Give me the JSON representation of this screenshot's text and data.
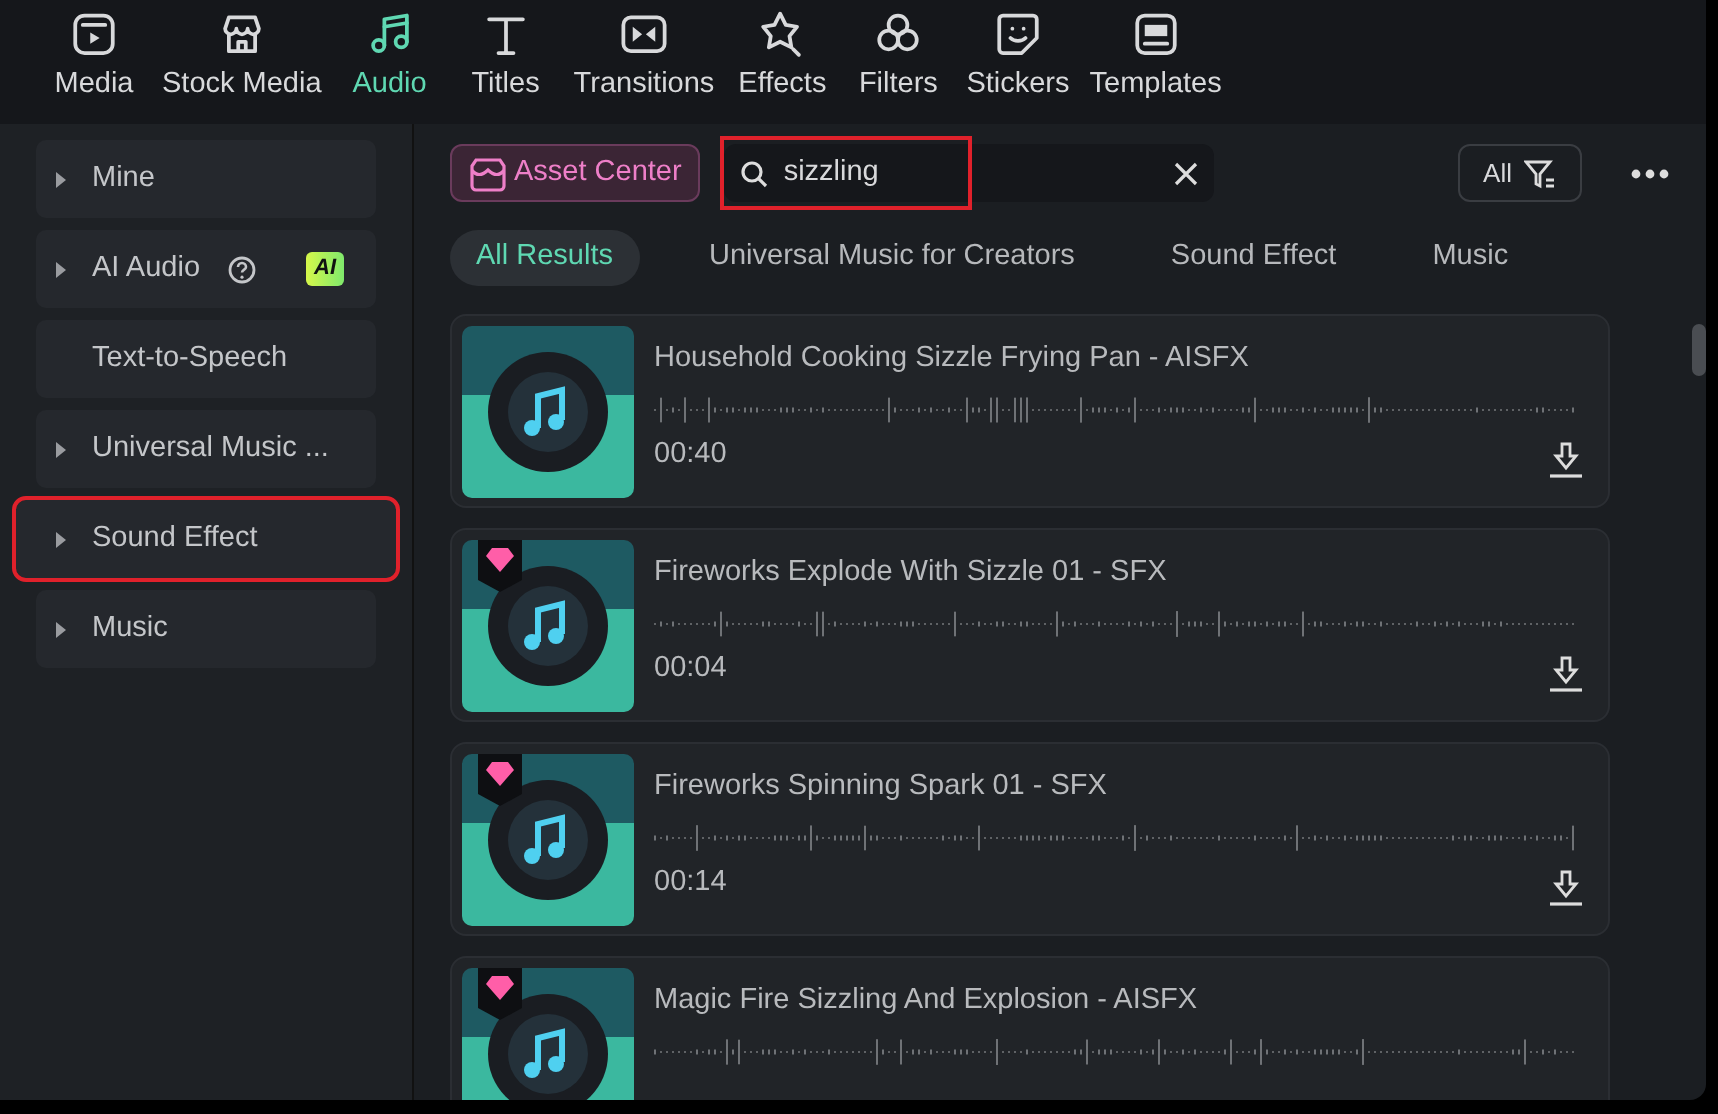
{
  "toolbar": [
    {
      "label": "Media",
      "selected": false,
      "kind": "media"
    },
    {
      "label": "Stock Media",
      "selected": false,
      "kind": "store"
    },
    {
      "label": "Audio",
      "selected": true,
      "kind": "music"
    },
    {
      "label": "Titles",
      "selected": false,
      "kind": "title"
    },
    {
      "label": "Transitions",
      "selected": false,
      "kind": "transition"
    },
    {
      "label": "Effects",
      "selected": false,
      "kind": "star"
    },
    {
      "label": "Filters",
      "selected": false,
      "kind": "filter"
    },
    {
      "label": "Stickers",
      "selected": false,
      "kind": "sticker"
    },
    {
      "label": "Templates",
      "selected": false,
      "kind": "template"
    }
  ],
  "sidebar": {
    "items": [
      {
        "label": "Mine",
        "expandable": true,
        "highlighted": false
      },
      {
        "label": "AI Audio",
        "expandable": true,
        "highlighted": false,
        "help": true,
        "badge": "AI"
      },
      {
        "label": "Text-to-Speech",
        "expandable": false,
        "highlighted": false
      },
      {
        "label": "Universal Music ...",
        "expandable": true,
        "highlighted": false
      },
      {
        "label": "Sound Effect",
        "expandable": true,
        "highlighted": true
      },
      {
        "label": "Music",
        "expandable": true,
        "highlighted": false
      }
    ]
  },
  "asset_center": "Asset Center",
  "search": {
    "value": "sizzling",
    "highlighted": true
  },
  "filter_button": "All",
  "result_tabs": [
    {
      "label": "All Results",
      "selected": true
    },
    {
      "label": "Universal Music for Creators",
      "selected": false
    },
    {
      "label": "Sound Effect",
      "selected": false
    },
    {
      "label": "Music",
      "selected": false
    }
  ],
  "results": [
    {
      "title": "Household Cooking Sizzle Frying Pan - AISFX",
      "duration": "00:40",
      "premium": false
    },
    {
      "title": "Fireworks Explode With Sizzle 01 - SFX",
      "duration": "00:04",
      "premium": true
    },
    {
      "title": "Fireworks Spinning Spark 01 - SFX",
      "duration": "00:14",
      "premium": true
    },
    {
      "title": "Magic Fire Sizzling And Explosion - AISFX",
      "premium": true
    }
  ]
}
